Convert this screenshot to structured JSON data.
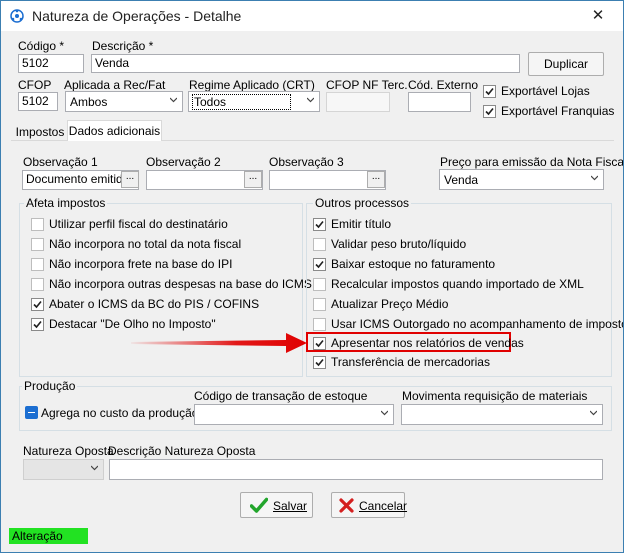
{
  "window": {
    "title": "Natureza de Operações - Detalhe",
    "close_glyph": "✕"
  },
  "header": {
    "codigo_label": "Código *",
    "codigo_value": "5102",
    "descricao_label": "Descrição *",
    "descricao_value": "Venda",
    "duplicar_label": "Duplicar",
    "cfop_label": "CFOP",
    "cfop_value": "5102",
    "aplicada_label": "Aplicada a Rec/Fat",
    "aplicada_value": "Ambos",
    "regime_label": "Regime Aplicado (CRT)",
    "regime_value": "Todos",
    "cfop_nf_terc_label": "CFOP NF Terc.",
    "cfop_nf_terc_value": "",
    "cod_externo_label": "Cód. Externo",
    "cod_externo_value": "",
    "exportavel_lojas_label": "Exportável Lojas",
    "exportavel_lojas_checked": true,
    "exportavel_franquias_label": "Exportável Franquias",
    "exportavel_franquias_checked": true
  },
  "tabs": [
    {
      "label": "Impostos",
      "active": false
    },
    {
      "label": "Dados adicionais",
      "active": true
    }
  ],
  "observacoes": {
    "obs1_label": "Observação 1",
    "obs1_value": "Documento emitido p",
    "obs2_label": "Observação 2",
    "obs2_value": "",
    "obs3_label": "Observação 3",
    "obs3_value": "",
    "ellipsis": "...",
    "preco_label": "Preço para emissão da Nota Fiscal",
    "preco_value": "Venda"
  },
  "afeta_impostos": {
    "title": "Afeta impostos",
    "items": [
      {
        "label": "Utilizar perfil fiscal do destinatário",
        "checked": false
      },
      {
        "label": "Não incorpora no total da nota fiscal",
        "checked": false
      },
      {
        "label": "Não incorpora frete na base do IPI",
        "checked": false
      },
      {
        "label": "Não incorpora outras despesas na base do ICMS",
        "checked": false
      },
      {
        "label": "Abater o ICMS da BC do PIS / COFINS",
        "checked": true
      },
      {
        "label": "Destacar \"De Olho no Imposto\"",
        "checked": true
      }
    ]
  },
  "outros_processos": {
    "title": "Outros processos",
    "items": [
      {
        "label": "Emitir título",
        "checked": true
      },
      {
        "label": "Validar peso bruto/líquido",
        "checked": false
      },
      {
        "label": "Baixar estoque no faturamento",
        "checked": true
      },
      {
        "label": "Recalcular impostos quando importado de XML",
        "checked": false
      },
      {
        "label": "Atualizar Preço Médio",
        "checked": false
      },
      {
        "label": "Usar ICMS Outorgado no acompanhamento de impostos",
        "checked": false
      },
      {
        "label": "Apresentar nos relatórios de vendas",
        "checked": true
      },
      {
        "label": "Transferência de mercadorias",
        "checked": true
      }
    ]
  },
  "producao": {
    "title": "Produção",
    "agrega_label": "Agrega no custo da produção",
    "cod_transacao_label": "Código de transação de estoque",
    "cod_transacao_value": "",
    "movimenta_label": "Movimenta requisição de materiais",
    "movimenta_value": ""
  },
  "natureza_oposta": {
    "label": "Natureza Oposta",
    "value": "",
    "descricao_label": "Descrição Natureza Oposta",
    "descricao_value": ""
  },
  "footer": {
    "salvar_label": "Salvar",
    "cancelar_label": "Cancelar"
  },
  "status": {
    "text": "Alteração"
  },
  "colors": {
    "highlight": "#e00000",
    "status_bg": "#22e222",
    "accent": "#1c6ed1"
  }
}
